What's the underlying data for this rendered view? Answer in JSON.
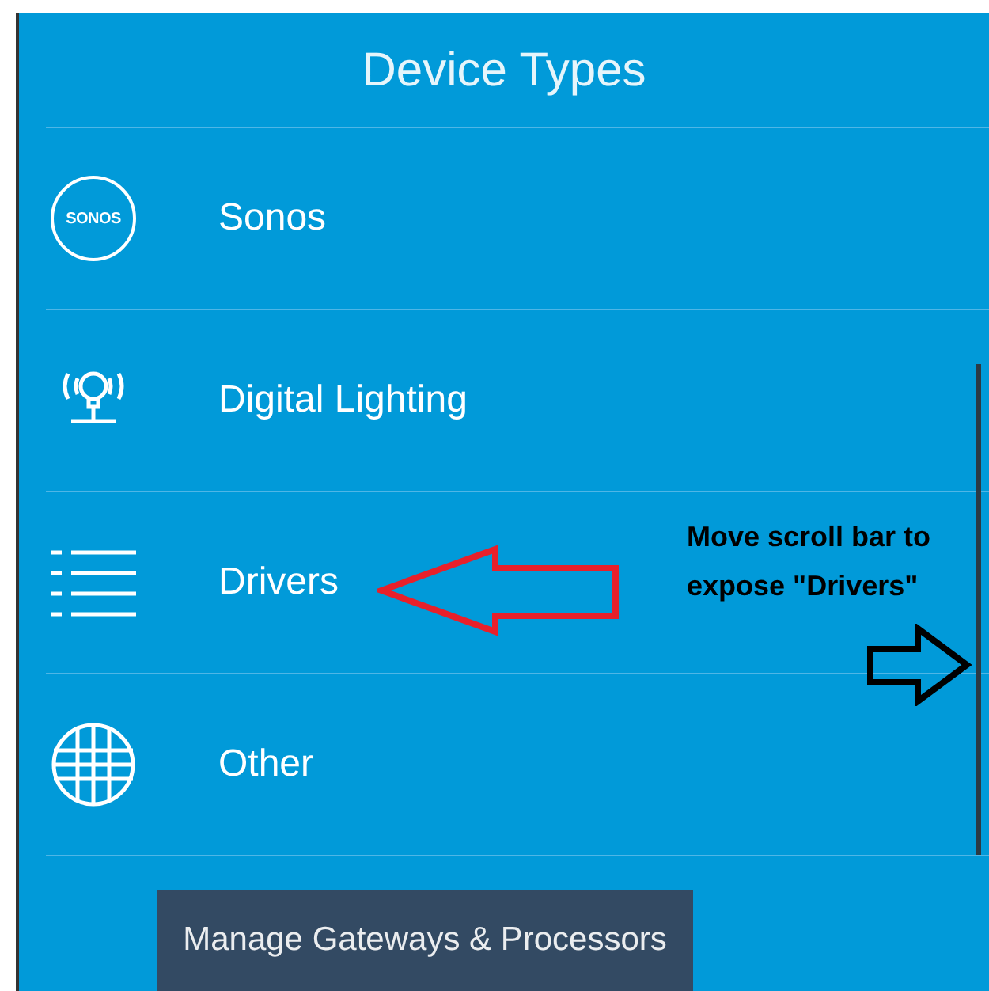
{
  "header": {
    "title": "Device Types"
  },
  "items": [
    {
      "kind": "sonos",
      "label": "Sonos",
      "icon_text": "SONOS"
    },
    {
      "kind": "lighting",
      "label": "Digital Lighting"
    },
    {
      "kind": "list",
      "label": "Drivers"
    },
    {
      "kind": "globe",
      "label": "Other"
    }
  ],
  "annotation": {
    "note": "Move scroll bar to expose \"Drivers\""
  },
  "button": {
    "label": "Manage Gateways & Processors"
  }
}
